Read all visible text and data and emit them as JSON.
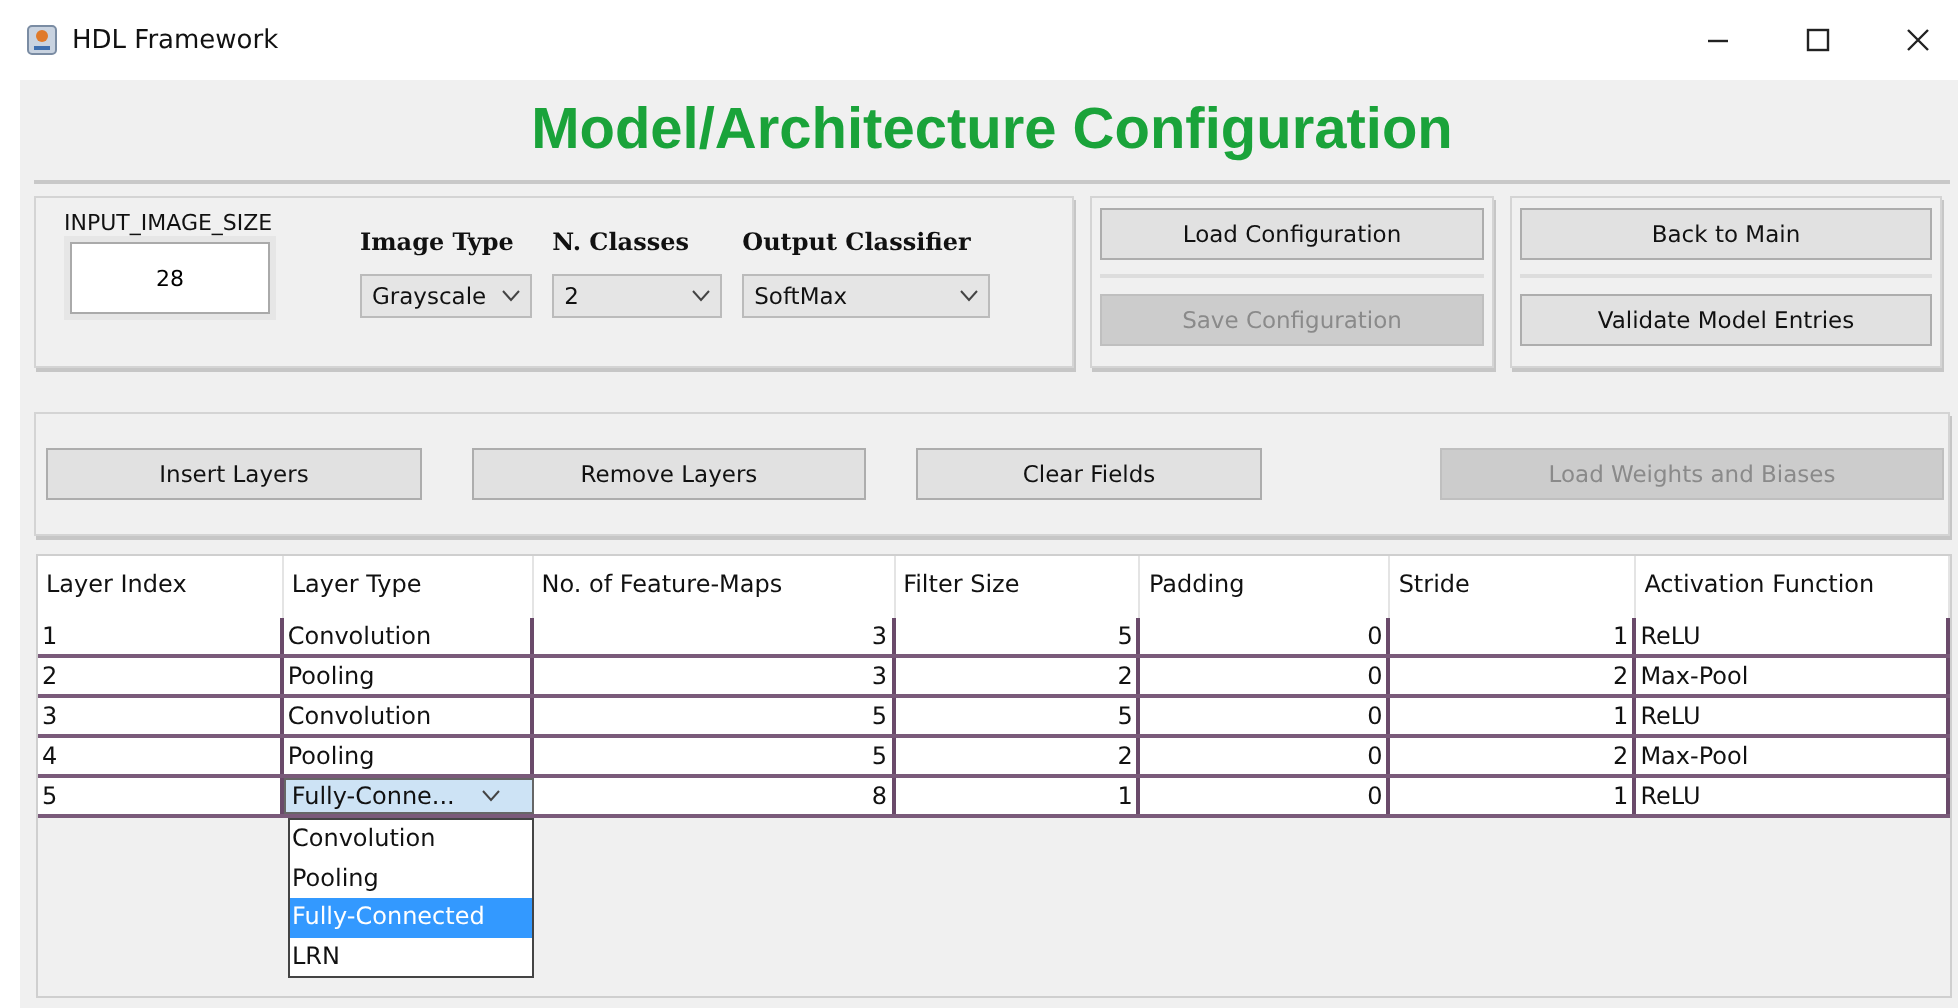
{
  "window": {
    "title": "HDL Framework"
  },
  "heading": "Model/Architecture Configuration",
  "config": {
    "input_size": {
      "label": "INPUT_IMAGE_SIZE",
      "value": "28"
    },
    "combos": [
      {
        "label": "Image Type",
        "value": "Grayscale"
      },
      {
        "label": "N. Classes",
        "value": "2"
      },
      {
        "label": "Output Classifier",
        "value": "SoftMax"
      }
    ]
  },
  "config_buttons": [
    {
      "label": "Load Configuration",
      "disabled": false
    },
    {
      "label": "Save Configuration",
      "disabled": true
    }
  ],
  "nav_buttons": [
    {
      "label": "Back to Main",
      "disabled": false
    },
    {
      "label": "Validate Model Entries",
      "disabled": false
    }
  ],
  "layer_buttons": [
    {
      "label": "Insert  Layers",
      "disabled": false
    },
    {
      "label": "Remove Layers",
      "disabled": false
    },
    {
      "label": "Clear Fields",
      "disabled": false
    },
    {
      "label": "Load Weights and Biases",
      "disabled": true
    }
  ],
  "table": {
    "columns": [
      "Layer Index",
      "Layer Type",
      "No. of Feature-Maps",
      "Filter Size",
      "Padding",
      "Stride",
      "Activation Function"
    ],
    "rows": [
      {
        "cells": [
          "1",
          "Convolution",
          "3",
          "5",
          "0",
          "1",
          "ReLU"
        ],
        "editing": false
      },
      {
        "cells": [
          "2",
          "Pooling",
          "3",
          "2",
          "0",
          "2",
          "Max-Pool"
        ],
        "editing": false
      },
      {
        "cells": [
          "3",
          "Convolution",
          "5",
          "5",
          "0",
          "1",
          "ReLU"
        ],
        "editing": false
      },
      {
        "cells": [
          "4",
          "Pooling",
          "5",
          "2",
          "0",
          "2",
          "Max-Pool"
        ],
        "editing": false
      },
      {
        "cells": [
          "5",
          "Fully-Conne...",
          "8",
          "1",
          "0",
          "1",
          "ReLU"
        ],
        "editing": true
      }
    ],
    "dropdown_options": [
      {
        "label": "Convolution",
        "selected": false
      },
      {
        "label": "Pooling",
        "selected": false
      },
      {
        "label": "Fully-Connected",
        "selected": true
      },
      {
        "label": "LRN",
        "selected": false
      }
    ]
  }
}
